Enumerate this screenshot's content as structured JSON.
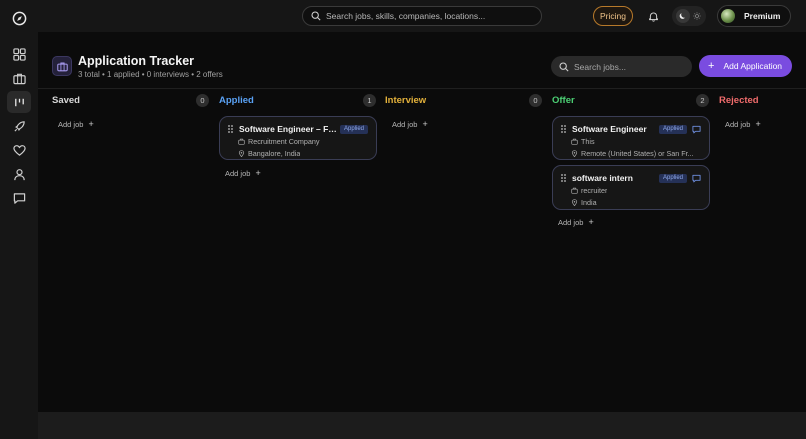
{
  "topbar": {
    "search_placeholder": "Search jobs, skills, companies, locations...",
    "pricing_label": "Pricing",
    "premium_label": "Premium"
  },
  "header": {
    "title": "Application Tracker",
    "subtitle": "3 total • 1 applied • 0 interviews • 2 offers",
    "search_placeholder": "Search jobs...",
    "add_button": "Add Application"
  },
  "columns": [
    {
      "title": "Saved",
      "count": "0",
      "color": "#d6d6d6",
      "add_label": "Add job"
    },
    {
      "title": "Applied",
      "count": "1",
      "color": "#5aa2f5",
      "add_label": "Add job"
    },
    {
      "title": "Interview",
      "count": "0",
      "color": "#e3b13b",
      "add_label": "Add job"
    },
    {
      "title": "Offer",
      "count": "2",
      "color": "#4ccf74",
      "add_label": "Add job"
    },
    {
      "title": "Rejected",
      "count": "",
      "color": "#ef6b6b",
      "add_label": "Add job"
    }
  ],
  "cards": {
    "applied": [
      {
        "title": "Software Engineer – Full...",
        "status": "Applied",
        "company": "Recruitment Company",
        "location": "Bangalore, India"
      }
    ],
    "offer": [
      {
        "title": "Software Engineer",
        "status": "Applied",
        "company": "This",
        "location": "Remote (United States) or San Fr..."
      },
      {
        "title": "software intern",
        "status": "Applied",
        "company": "recruiter",
        "location": "India"
      }
    ]
  },
  "icons": {
    "logo": "compass-icon",
    "dashboard": "grid-icon",
    "jobs": "briefcase-icon",
    "tracker": "kanban-icon",
    "launch": "rocket-icon",
    "saved": "heart-icon",
    "profile": "user-icon",
    "messages": "message-icon"
  },
  "colors": {
    "accent": "#7a4ce0",
    "pricing": "#b7792a",
    "badge_bg": "#253157",
    "badge_text": "#8fa9ea"
  }
}
